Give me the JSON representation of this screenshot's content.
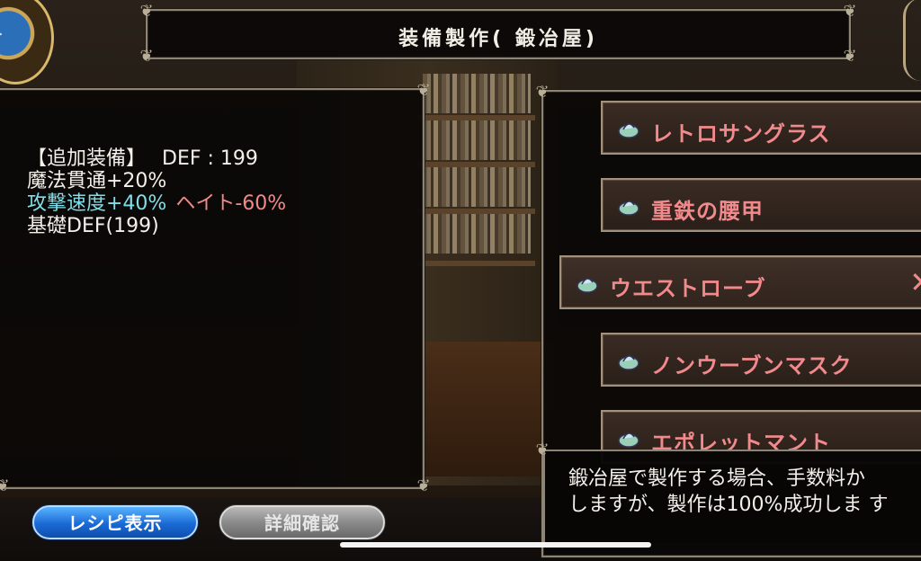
{
  "header": {
    "title": "装備製作( 鍛冶屋)"
  },
  "stats": {
    "line1_label": "【追加装備】",
    "line1_value": "DEF : 199",
    "line2": "魔法貫通+20%",
    "line3_cyan": "攻撃速度+40%",
    "line3_red": "ヘイト-60%",
    "line4": "基礎DEF(199)"
  },
  "items": [
    {
      "label": "レトロサングラス",
      "icon": "lamp-icon"
    },
    {
      "label": "重鉄の腰甲",
      "icon": "lamp-icon"
    },
    {
      "label": "ウエストローブ",
      "icon": "lamp-icon",
      "selected": true
    },
    {
      "label": "ノンウーブンマスク",
      "icon": "lamp-icon"
    },
    {
      "label": "エポレットマント",
      "icon": "lamp-icon"
    }
  ],
  "message": {
    "line1": "鍛冶屋で製作する場合、手数料か",
    "line2": "しますが、製作は100%成功しま す"
  },
  "buttons": {
    "recipe": "レシピ表示",
    "detail": "詳細確認"
  },
  "colors": {
    "accent_red": "#f08a8a",
    "accent_cyan": "#7fdfe8",
    "button_blue": "#1a6ad6"
  }
}
